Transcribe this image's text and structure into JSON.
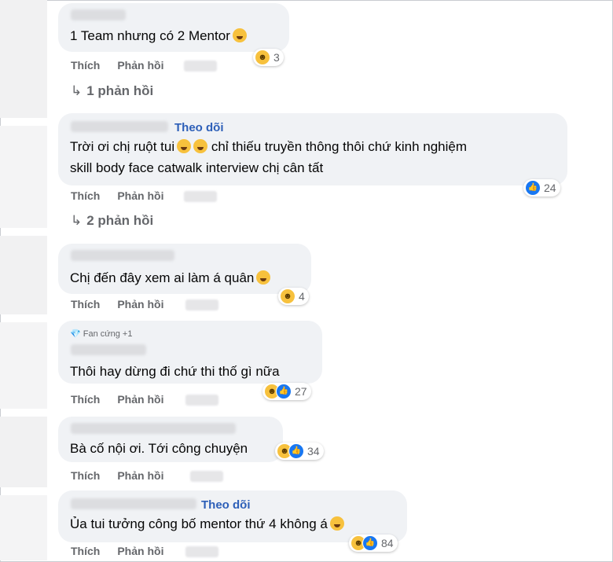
{
  "actions": {
    "like": "Thích",
    "reply": "Phản hồi"
  },
  "comments": [
    {
      "text": "1 Team nhưng có 2 Mentor",
      "reaction_count": "3",
      "replies": "1 phản hồi"
    },
    {
      "follow": "Theo dõi",
      "line1": "Trời ơi chị ruột tui",
      "line1b": "chỉ thiếu truyền thông thôi chứ kinh nghiệm",
      "line2": "skill body face catwalk interview chị cân tất",
      "reaction_count": "24",
      "replies": "2 phản hồi"
    },
    {
      "text": "Chị đến đây xem ai làm á quân",
      "reaction_count": "4"
    },
    {
      "badge": "Fan cứng +1",
      "text": "Thôi hay dừng đi chứ thi thố gì nữa",
      "reaction_count": "27"
    },
    {
      "text": "Bà cố nội ơi. Tới công chuyện",
      "reaction_count": "34"
    },
    {
      "follow": "Theo dõi",
      "text": "Ủa tui tưởng công bố mentor thứ 4 không á",
      "reaction_count": "84"
    }
  ],
  "icons": {
    "like": "like-icon",
    "haha": "haha-icon",
    "reply_arrow": "reply-arrow-icon",
    "diamond": "diamond-icon"
  },
  "colors": {
    "bubble": "#f0f2f5",
    "link": "#2d5fb8",
    "muted": "#65676b",
    "like_blue": "#1877f2",
    "haha_yellow": "#f7c13d"
  }
}
